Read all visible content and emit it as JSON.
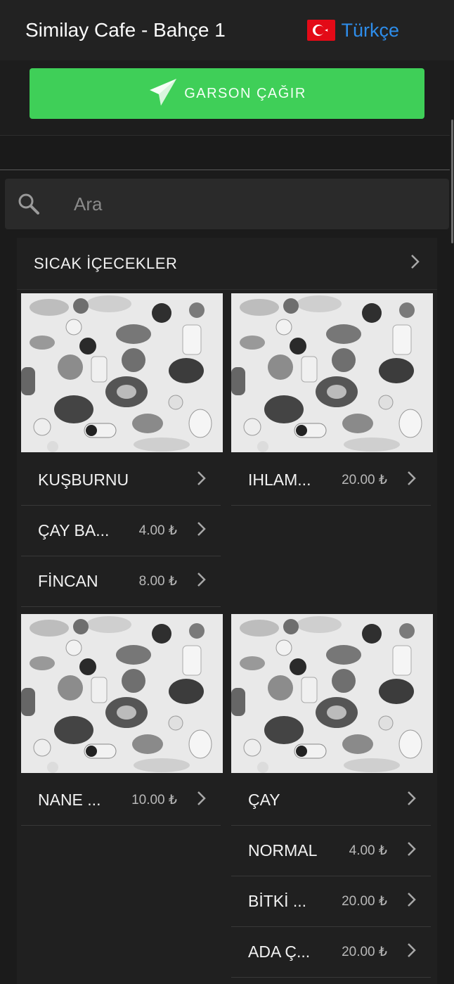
{
  "header": {
    "title": "Similay Cafe - Bahçe 1",
    "language": "Türkçe"
  },
  "call_waiter": {
    "label": "GARSON ÇAĞIR"
  },
  "search": {
    "placeholder": "Ara"
  },
  "category": {
    "title": "SICAK İÇECEKLER",
    "groups": [
      {
        "items": [
          {
            "name": "KUŞBURNU",
            "price": ""
          },
          {
            "name": "ÇAY BA...",
            "price": "4.00 ₺"
          },
          {
            "name": "FİNCAN",
            "price": "8.00 ₺"
          }
        ]
      },
      {
        "items": [
          {
            "name": "IHLAM...",
            "price": "20.00 ₺"
          }
        ]
      },
      {
        "items": [
          {
            "name": "NANE ...",
            "price": "10.00 ₺"
          }
        ]
      },
      {
        "items": [
          {
            "name": "ÇAY",
            "price": ""
          },
          {
            "name": "NORMAL",
            "price": "4.00 ₺"
          },
          {
            "name": "BİTKİ ...",
            "price": "20.00 ₺"
          },
          {
            "name": "ADA Ç...",
            "price": "20.00 ₺"
          }
        ]
      }
    ]
  },
  "colors": {
    "accent_green": "#3fcf58",
    "language_blue": "#2e8dea",
    "flag_red": "#e30a17"
  },
  "icons": {
    "call": "paper-plane-icon",
    "search": "search-icon",
    "row": "chevron-right-icon"
  }
}
